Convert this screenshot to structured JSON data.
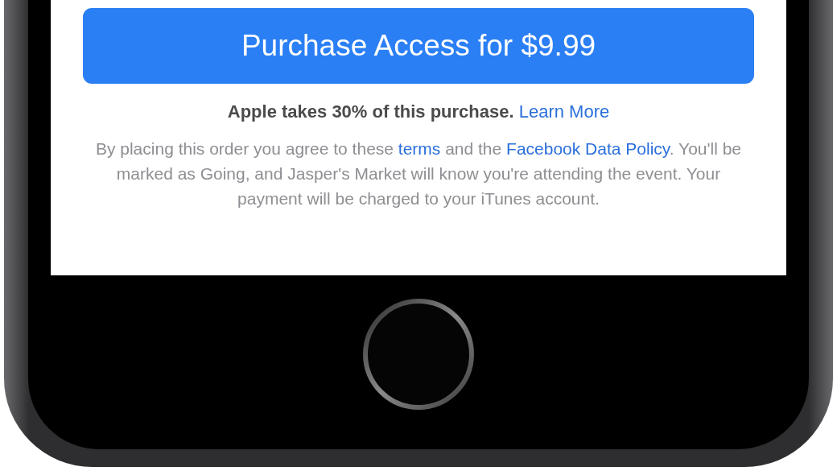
{
  "purchase_button": {
    "label": "Purchase Access for $9.99"
  },
  "fee_notice": {
    "text": "Apple takes 30% of this purchase.",
    "link": "Learn More"
  },
  "terms": {
    "parts": [
      {
        "kind": "text",
        "text": "By placing this order you agree to these "
      },
      {
        "kind": "link",
        "text": "terms"
      },
      {
        "kind": "text",
        "text": " and the "
      },
      {
        "kind": "link",
        "text": "Facebook Data Policy"
      },
      {
        "kind": "text",
        "text": ". You'll be marked as Going, and Jasper's Market will know you're attending the event. Your payment will be charged to your iTunes account."
      }
    ]
  }
}
